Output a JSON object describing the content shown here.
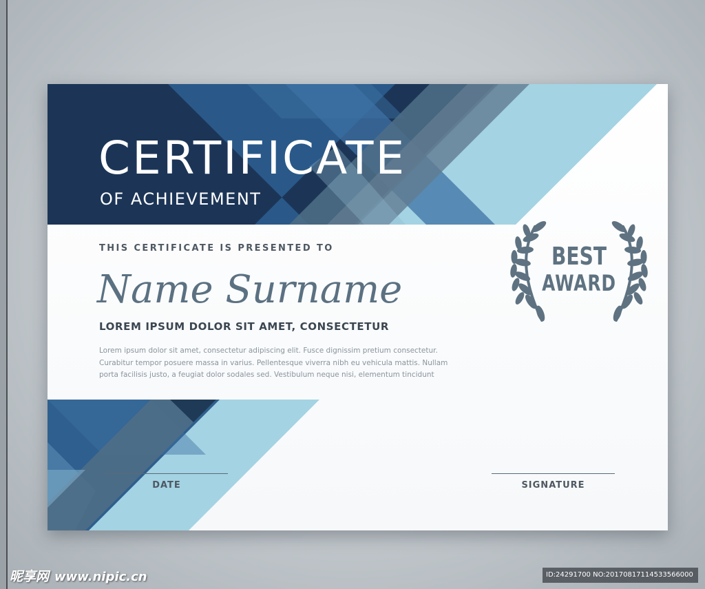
{
  "certificate": {
    "title": "CERTIFICATE",
    "subtitle": "OF ACHIEVEMENT",
    "presented_to": "THIS CERTIFICATE IS PRESENTED TO",
    "recipient_name": "Name Surname",
    "headline": "LOREM IPSUM DOLOR SIT AMET, CONSECTETUR",
    "body_lines": [
      "Lorem ipsum dolor sit amet, consectetur adipiscing elit. Fusce dignissim pretium consectetur.",
      "Curabitur tempor posuere massa in varius. Pellentesque viverra nibh eu vehicula mattis. Nullam",
      "porta facilisis justo, a feugiat dolor sodales sed. Vestibulum neque nisi, elementum tincidunt"
    ],
    "award": {
      "line1": "BEST",
      "line2": "AWARD",
      "icon": "laurel-wreath-icon"
    },
    "date_label": "DATE",
    "signature_label": "SIGNATURE"
  },
  "watermark": {
    "logo": "昵享网",
    "site": "www.nipic.cn",
    "id_text": "ID:24291700 NO:20170817114533566000"
  },
  "colors": {
    "navy": "#1c3557",
    "blue": "#2e5f8f",
    "steel": "#5b7182",
    "light_blue": "#a4d3e3",
    "text_dark": "#3b4650",
    "text_muted": "#8a949c"
  }
}
